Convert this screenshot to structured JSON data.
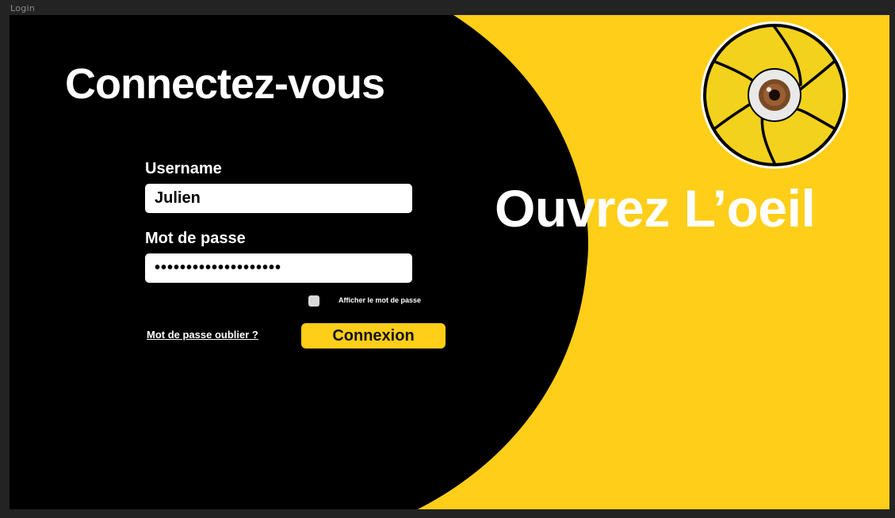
{
  "window": {
    "title": "Login"
  },
  "form": {
    "heading": "Connectez-vous",
    "username_label": "Username",
    "username_value": "Julien",
    "password_label": "Mot de passe",
    "password_value": "••••••••••••••••••••",
    "show_password_label": "Afficher le mot de passe",
    "show_password_checked": false,
    "forgot_link": "Mot de passe oublier ?",
    "submit_label": "Connexion"
  },
  "branding": {
    "tagline": "Ouvrez L’oeil",
    "logo_icon": "eye-aperture-icon"
  },
  "colors": {
    "accent": "#fece19",
    "panel": "#000000",
    "text": "#ffffff",
    "chrome": "#232323"
  }
}
